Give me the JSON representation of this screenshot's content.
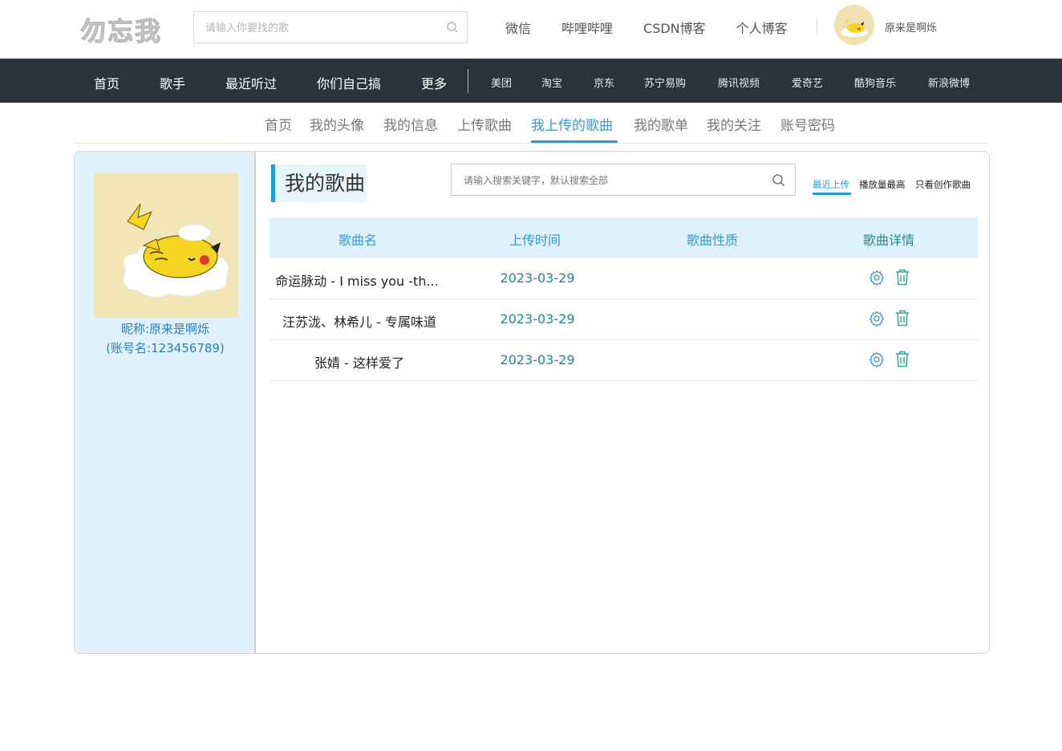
{
  "header": {
    "logo": "勿忘我",
    "search_placeholder": "请输入你要找的歌",
    "links": [
      "微信",
      "哔哩哔哩",
      "CSDN博客",
      "个人博客"
    ],
    "username": "原来是啊烁"
  },
  "nav": {
    "main": [
      "首页",
      "歌手",
      "最近听过",
      "你们自己搞",
      "更多"
    ],
    "external": [
      "美团",
      "淘宝",
      "京东",
      "苏宁易购",
      "腾讯视频",
      "爱奇艺",
      "酷狗音乐",
      "新浪微博"
    ]
  },
  "tabs": {
    "items": [
      "首页",
      "我的头像",
      "我的信息",
      "上传歌曲",
      "我上传的歌曲",
      "我的歌单",
      "我的关注",
      "账号密码"
    ],
    "active": "我上传的歌曲"
  },
  "profile": {
    "nickname": "昵称:原来是啊烁",
    "account": "(账号名:123456789)"
  },
  "content": {
    "title": "我的歌曲",
    "search_placeholder": "请输入搜索关键字，默认搜索全部",
    "sort_options": [
      "最近上传",
      "播放量最高",
      "只看创作歌曲"
    ],
    "sort_active": "最近上传"
  },
  "table": {
    "headers": [
      "歌曲名",
      "上传时间",
      "歌曲性质",
      "歌曲详情"
    ],
    "rows": [
      {
        "name": "命运脉动 - I miss you -th...",
        "date": "2023-03-29",
        "nature": ""
      },
      {
        "name": "汪苏泷、林希儿 - 专属味道",
        "date": "2023-03-29",
        "nature": ""
      },
      {
        "name": "张婧 - 这样爱了",
        "date": "2023-03-29",
        "nature": ""
      }
    ]
  },
  "colors": {
    "accent": "#1a9be4",
    "nav_bg": "#2c323b",
    "side_bg": "#e0f2fd",
    "teal": "#1e8a8a"
  }
}
